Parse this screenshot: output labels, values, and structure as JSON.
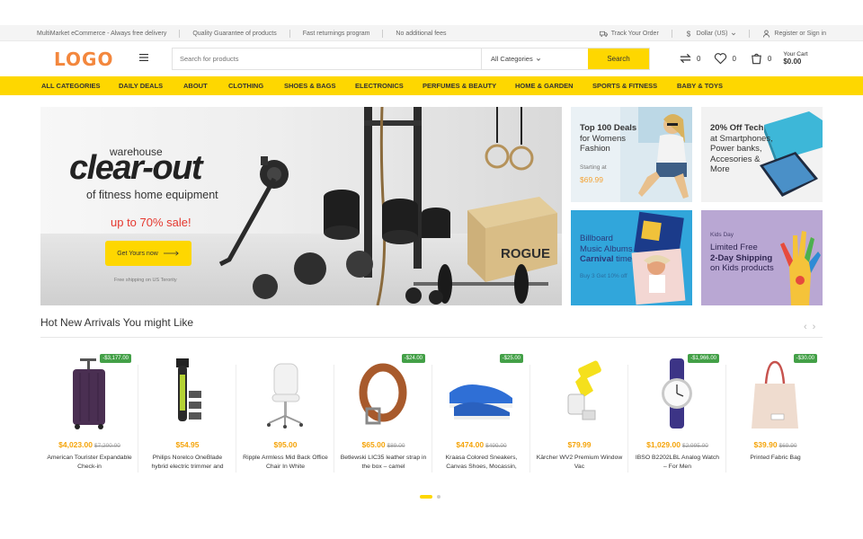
{
  "topbar": {
    "left": [
      "MultiMarket eCommerce - Always free delivery",
      "Quality Guarantee of products",
      "Fast returnings program",
      "No additional fees"
    ],
    "track": "Track Your Order",
    "currency": "Dollar (US)",
    "account": "Register or Sign in"
  },
  "header": {
    "logo": "LOGO",
    "search_placeholder": "Search for products",
    "category": "All Categories",
    "search_button": "Search",
    "compare_count": "0",
    "wishlist_count": "0",
    "cart_count": "0",
    "cart_label": "Your Cart",
    "cart_total": "$0.00"
  },
  "nav": [
    "ALL CATEGORIES",
    "DAILY DEALS",
    "ABOUT",
    "CLOTHING",
    "SHOES & BAGS",
    "ELECTRONICS",
    "PERFUMES & BEAUTY",
    "HOME & GARDEN",
    "SPORTS & FITNESS",
    "BABY & TOYS"
  ],
  "hero": {
    "pre": "warehouse",
    "title": "clear-out",
    "subtitle": "of fitness home equipment",
    "sale": "up to 70% sale!",
    "cta": "Get Yours now",
    "shipping": "Free shipping on US Terority",
    "box_text": "ROGUE"
  },
  "promos": [
    {
      "bold": "Top 100 Deals",
      "rest": [
        "for Womens",
        "Fashion"
      ],
      "small": "Starting at",
      "price": "$69.99"
    },
    {
      "bold": "20% Off Tech",
      "rest": [
        "at Smartphones,",
        "Power banks,",
        "Accesories &",
        "More"
      ]
    },
    {
      "l1": "Billboard",
      "l2": "Music Albums",
      "l3b": "Carnival",
      "l3": " time",
      "small": "Buy 3 Get 10% off"
    },
    {
      "small": "Kids Day",
      "l1": "Limited Free",
      "l2b": "2-Day Shipping",
      "l3": "on Kids products"
    }
  ],
  "section": {
    "title": "Hot New Arrivals You might Like",
    "prev": "‹",
    "next": "›"
  },
  "products": [
    {
      "badge": "-$3,177.00",
      "price": "$4,023.00",
      "old": "$7,200.00",
      "name": "American Tourister Expandable Check-in"
    },
    {
      "badge": "",
      "price": "$54.95",
      "old": "",
      "name": "Philips Norelco OneBlade hybrid electric trimmer and"
    },
    {
      "badge": "",
      "price": "$95.00",
      "old": "",
      "name": "Ripple Armless Mid Back Office Chair In White"
    },
    {
      "badge": "-$24.00",
      "price": "$65.00",
      "old": "$89.00",
      "name": "Betlewski LIC35 leather strap in the box – camel"
    },
    {
      "badge": "-$25.00",
      "price": "$474.00",
      "old": "$499.00",
      "name": "Kraasa Colored Sneakers, Canvas Shoes, Mocassin,"
    },
    {
      "badge": "",
      "price": "$79.99",
      "old": "",
      "name": "Kärcher WV2 Premium Window Vac"
    },
    {
      "badge": "-$1,966.00",
      "price": "$1,029.00",
      "old": "$2,995.00",
      "name": "IBSO B2202LBL Analog Watch – For Men"
    },
    {
      "badge": "-$30.00",
      "price": "$39.90",
      "old": "$69.90",
      "name": "Printed Fabric Bag"
    }
  ],
  "colors": {
    "accent": "#fed700",
    "logo": "#f3873d",
    "badge": "#43a047",
    "price": "#f5a40a",
    "sale": "#e5382f"
  }
}
